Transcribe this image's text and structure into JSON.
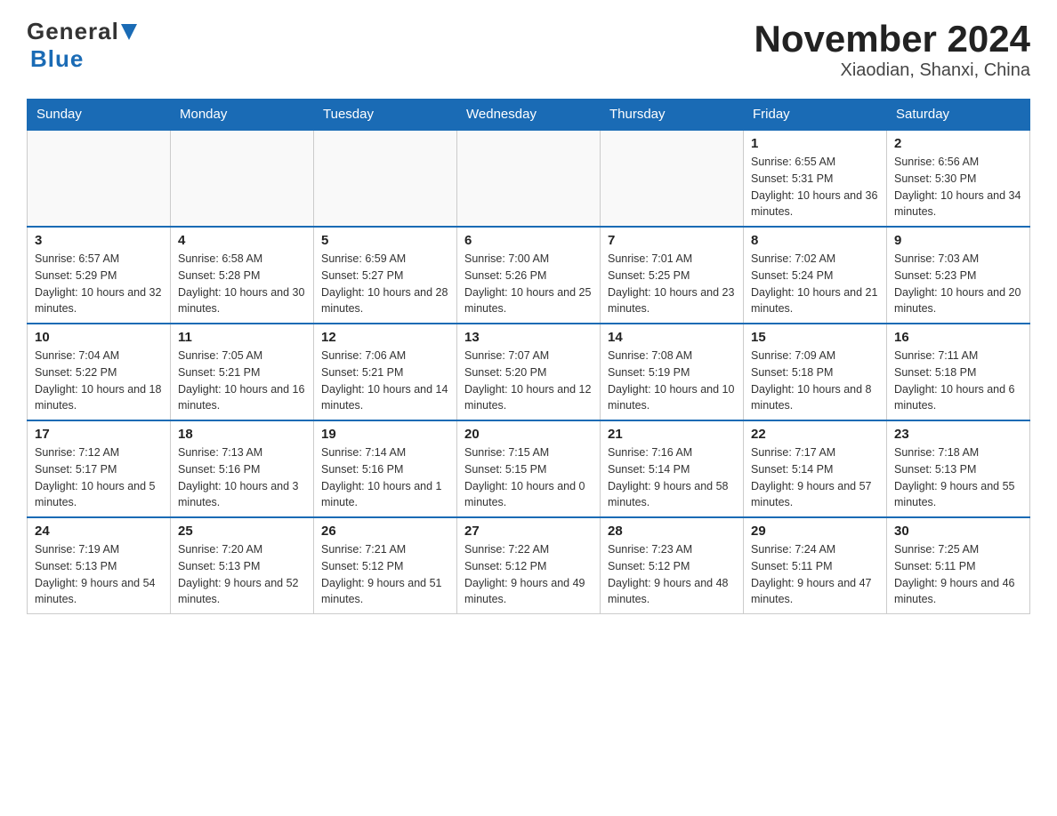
{
  "header": {
    "logo_general": "General",
    "logo_blue": "Blue",
    "title": "November 2024",
    "subtitle": "Xiaodian, Shanxi, China"
  },
  "calendar": {
    "days_of_week": [
      "Sunday",
      "Monday",
      "Tuesday",
      "Wednesday",
      "Thursday",
      "Friday",
      "Saturday"
    ],
    "weeks": [
      [
        {
          "day": "",
          "info": ""
        },
        {
          "day": "",
          "info": ""
        },
        {
          "day": "",
          "info": ""
        },
        {
          "day": "",
          "info": ""
        },
        {
          "day": "",
          "info": ""
        },
        {
          "day": "1",
          "info": "Sunrise: 6:55 AM\nSunset: 5:31 PM\nDaylight: 10 hours and 36 minutes."
        },
        {
          "day": "2",
          "info": "Sunrise: 6:56 AM\nSunset: 5:30 PM\nDaylight: 10 hours and 34 minutes."
        }
      ],
      [
        {
          "day": "3",
          "info": "Sunrise: 6:57 AM\nSunset: 5:29 PM\nDaylight: 10 hours and 32 minutes."
        },
        {
          "day": "4",
          "info": "Sunrise: 6:58 AM\nSunset: 5:28 PM\nDaylight: 10 hours and 30 minutes."
        },
        {
          "day": "5",
          "info": "Sunrise: 6:59 AM\nSunset: 5:27 PM\nDaylight: 10 hours and 28 minutes."
        },
        {
          "day": "6",
          "info": "Sunrise: 7:00 AM\nSunset: 5:26 PM\nDaylight: 10 hours and 25 minutes."
        },
        {
          "day": "7",
          "info": "Sunrise: 7:01 AM\nSunset: 5:25 PM\nDaylight: 10 hours and 23 minutes."
        },
        {
          "day": "8",
          "info": "Sunrise: 7:02 AM\nSunset: 5:24 PM\nDaylight: 10 hours and 21 minutes."
        },
        {
          "day": "9",
          "info": "Sunrise: 7:03 AM\nSunset: 5:23 PM\nDaylight: 10 hours and 20 minutes."
        }
      ],
      [
        {
          "day": "10",
          "info": "Sunrise: 7:04 AM\nSunset: 5:22 PM\nDaylight: 10 hours and 18 minutes."
        },
        {
          "day": "11",
          "info": "Sunrise: 7:05 AM\nSunset: 5:21 PM\nDaylight: 10 hours and 16 minutes."
        },
        {
          "day": "12",
          "info": "Sunrise: 7:06 AM\nSunset: 5:21 PM\nDaylight: 10 hours and 14 minutes."
        },
        {
          "day": "13",
          "info": "Sunrise: 7:07 AM\nSunset: 5:20 PM\nDaylight: 10 hours and 12 minutes."
        },
        {
          "day": "14",
          "info": "Sunrise: 7:08 AM\nSunset: 5:19 PM\nDaylight: 10 hours and 10 minutes."
        },
        {
          "day": "15",
          "info": "Sunrise: 7:09 AM\nSunset: 5:18 PM\nDaylight: 10 hours and 8 minutes."
        },
        {
          "day": "16",
          "info": "Sunrise: 7:11 AM\nSunset: 5:18 PM\nDaylight: 10 hours and 6 minutes."
        }
      ],
      [
        {
          "day": "17",
          "info": "Sunrise: 7:12 AM\nSunset: 5:17 PM\nDaylight: 10 hours and 5 minutes."
        },
        {
          "day": "18",
          "info": "Sunrise: 7:13 AM\nSunset: 5:16 PM\nDaylight: 10 hours and 3 minutes."
        },
        {
          "day": "19",
          "info": "Sunrise: 7:14 AM\nSunset: 5:16 PM\nDaylight: 10 hours and 1 minute."
        },
        {
          "day": "20",
          "info": "Sunrise: 7:15 AM\nSunset: 5:15 PM\nDaylight: 10 hours and 0 minutes."
        },
        {
          "day": "21",
          "info": "Sunrise: 7:16 AM\nSunset: 5:14 PM\nDaylight: 9 hours and 58 minutes."
        },
        {
          "day": "22",
          "info": "Sunrise: 7:17 AM\nSunset: 5:14 PM\nDaylight: 9 hours and 57 minutes."
        },
        {
          "day": "23",
          "info": "Sunrise: 7:18 AM\nSunset: 5:13 PM\nDaylight: 9 hours and 55 minutes."
        }
      ],
      [
        {
          "day": "24",
          "info": "Sunrise: 7:19 AM\nSunset: 5:13 PM\nDaylight: 9 hours and 54 minutes."
        },
        {
          "day": "25",
          "info": "Sunrise: 7:20 AM\nSunset: 5:13 PM\nDaylight: 9 hours and 52 minutes."
        },
        {
          "day": "26",
          "info": "Sunrise: 7:21 AM\nSunset: 5:12 PM\nDaylight: 9 hours and 51 minutes."
        },
        {
          "day": "27",
          "info": "Sunrise: 7:22 AM\nSunset: 5:12 PM\nDaylight: 9 hours and 49 minutes."
        },
        {
          "day": "28",
          "info": "Sunrise: 7:23 AM\nSunset: 5:12 PM\nDaylight: 9 hours and 48 minutes."
        },
        {
          "day": "29",
          "info": "Sunrise: 7:24 AM\nSunset: 5:11 PM\nDaylight: 9 hours and 47 minutes."
        },
        {
          "day": "30",
          "info": "Sunrise: 7:25 AM\nSunset: 5:11 PM\nDaylight: 9 hours and 46 minutes."
        }
      ]
    ]
  }
}
